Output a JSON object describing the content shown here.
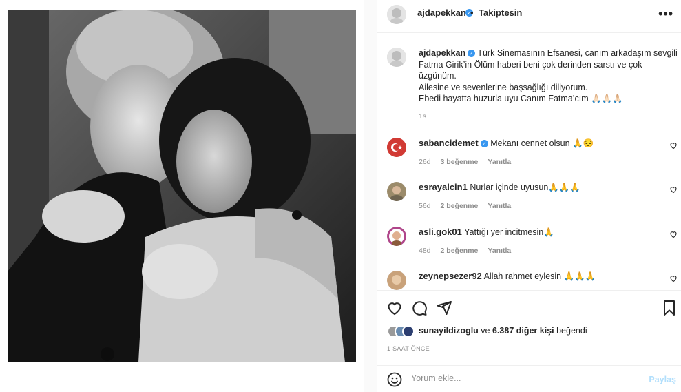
{
  "header": {
    "username": "ajdapekkan",
    "separator": "•",
    "follow_status": "Takiptesin",
    "more": "•••"
  },
  "caption": {
    "username": "ajdapekkan",
    "line1": "Türk Sinemasının Efsanesi, canım arkadaşım sevgili Fatma Girik’in Ölüm haberi beni çok derinden sarstı ve çok üzgünüm.",
    "line2": "Ailesine ve sevenlerine başsağlığı diliyorum.",
    "line3": "Ebedi hayatta huzurla uyu Canım Fatma’cım 🙏🏻🙏🏻🙏🏻",
    "time": "1s"
  },
  "comments": [
    {
      "username": "sabancidemet",
      "verified": true,
      "text": "Mekanı cennet olsun 🙏😔",
      "age": "26d",
      "likes": "3 beğenme",
      "reply": "Yanıtla",
      "avatar_color": "#c9302c"
    },
    {
      "username": "esrayalcin1",
      "verified": false,
      "text": "Nurlar içinde uyusun🙏🙏🙏",
      "age": "56d",
      "likes": "2 beğenme",
      "reply": "Yanıtla",
      "avatar_color": "#8a7a5a"
    },
    {
      "username": "asli.gok01",
      "verified": false,
      "text": "Yattığı yer incitmesin🙏",
      "age": "48d",
      "likes": "2 beğenme",
      "reply": "Yanıtla",
      "avatar_color": "#b0458a"
    },
    {
      "username": "zeynepsezer92",
      "verified": false,
      "text": "Allah rahmet eylesin 🙏🙏🙏",
      "age": "",
      "likes": "",
      "reply": "",
      "avatar_color": "#c9a27a"
    }
  ],
  "likes": {
    "user": "sunayildizoglu",
    "connector": "ve",
    "others": "6.387 diğer kişi",
    "suffix": "beğendi"
  },
  "post_time": "1 SAAT ÖNCE",
  "add_comment": {
    "placeholder": "Yorum ekle...",
    "post_label": "Paylaş"
  },
  "colors": {
    "verified": "#3897f0",
    "secondary_text": "#8e8e8e",
    "post_disabled": "#b2dffc"
  }
}
